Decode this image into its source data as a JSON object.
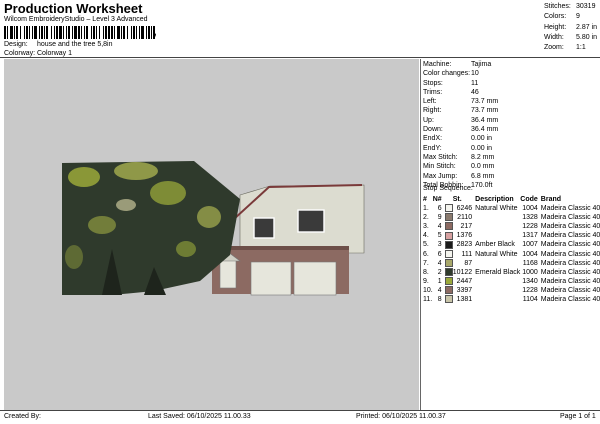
{
  "header": {
    "title": "Production Worksheet",
    "subtitle": "Wilcom EmbroideryStudio – Level 3 Advanced",
    "barcode_char": ",",
    "design_label": "Design:",
    "design_value": "house and the tree 5,8in",
    "colorway_label": "Colorway:",
    "colorway_value": "Colorway 1"
  },
  "stats": [
    {
      "label": "Stitches:",
      "value": "30319"
    },
    {
      "label": "Colors:",
      "value": "9"
    },
    {
      "label": "Height:",
      "value": "2.87 in"
    },
    {
      "label": "Width:",
      "value": "5.80 in"
    },
    {
      "label": "Zoom:",
      "value": "1:1"
    }
  ],
  "specs": [
    {
      "label": "Machine:",
      "value": "Tajima"
    },
    {
      "label": "Color changes:",
      "value": "10"
    },
    {
      "label": "Stops:",
      "value": "11"
    },
    {
      "label": "Trims:",
      "value": "46"
    },
    {
      "label": "Left:",
      "value": "73.7 mm"
    },
    {
      "label": "Right:",
      "value": "73.7 mm"
    },
    {
      "label": "Up:",
      "value": "36.4 mm"
    },
    {
      "label": "Down:",
      "value": "36.4 mm"
    },
    {
      "label": "EndX:",
      "value": "0.00 in"
    },
    {
      "label": "EndY:",
      "value": "0.00 in"
    },
    {
      "label": "Max Stitch:",
      "value": "8.2 mm"
    },
    {
      "label": "Min Stitch:",
      "value": "0.0 mm"
    },
    {
      "label": "Max Jump:",
      "value": "6.8 mm"
    },
    {
      "label": "Total Bobbin:",
      "value": "170.0ft"
    }
  ],
  "sequence": {
    "title": "Stop Sequence:",
    "headers": {
      "n": "#",
      "cn": "N#",
      "st": "St.",
      "desc": "Description",
      "code": "Code",
      "brand": "Brand"
    },
    "rows": [
      {
        "n": "1.",
        "cn": "6",
        "color": "#f4f4ee",
        "st": "6246",
        "desc": "Natural White",
        "code": "1004",
        "brand": "Madeira Classic 40"
      },
      {
        "n": "2.",
        "cn": "9",
        "color": "#8a7a6e",
        "st": "2110",
        "desc": "",
        "code": "1328",
        "brand": "Madeira Classic 40"
      },
      {
        "n": "3.",
        "cn": "4",
        "color": "#8c6a62",
        "st": "217",
        "desc": "",
        "code": "1228",
        "brand": "Madeira Classic 40"
      },
      {
        "n": "4.",
        "cn": "5",
        "color": "#d6a0a0",
        "st": "1376",
        "desc": "",
        "code": "1317",
        "brand": "Madeira Classic 40"
      },
      {
        "n": "5.",
        "cn": "3",
        "color": "#1a1a1a",
        "st": "2823",
        "desc": "Amber Black",
        "code": "1007",
        "brand": "Madeira Classic 40"
      },
      {
        "n": "6.",
        "cn": "6",
        "color": "#f4f4ee",
        "st": "111",
        "desc": "Natural White",
        "code": "1004",
        "brand": "Madeira Classic 40"
      },
      {
        "n": "7.",
        "cn": "4",
        "color": "#a8a86a",
        "st": "87",
        "desc": "",
        "code": "1168",
        "brand": "Madeira Classic 40"
      },
      {
        "n": "8.",
        "cn": "2",
        "color": "#2f3a2c",
        "st": "10122",
        "desc": "Emerald Black",
        "code": "1000",
        "brand": "Madeira Classic 40"
      },
      {
        "n": "9.",
        "cn": "1",
        "color": "#9aa83a",
        "st": "2447",
        "desc": "",
        "code": "1340",
        "brand": "Madeira Classic 40"
      },
      {
        "n": "10.",
        "cn": "4",
        "color": "#8c6a62",
        "st": "3397",
        "desc": "",
        "code": "1228",
        "brand": "Madeira Classic 40"
      },
      {
        "n": "11.",
        "cn": "8",
        "color": "#c8c4a8",
        "st": "1381",
        "desc": "",
        "code": "1104",
        "brand": "Madeira Classic 40"
      }
    ]
  },
  "footer": {
    "created_by": "Created By:",
    "last_saved": "Last Saved: 06/10/2025 11.00.33",
    "printed": "Printed: 06/10/2025 11.00.37",
    "page": "Page 1 of 1"
  },
  "preview": {
    "background": "#c9c9c9",
    "tree_dark": "#2f3a2c",
    "tree_light": "#9aa83a",
    "siding": "#dcdcd0",
    "brick": "#8c6a62",
    "roof_trim": "#7a3a3a"
  }
}
